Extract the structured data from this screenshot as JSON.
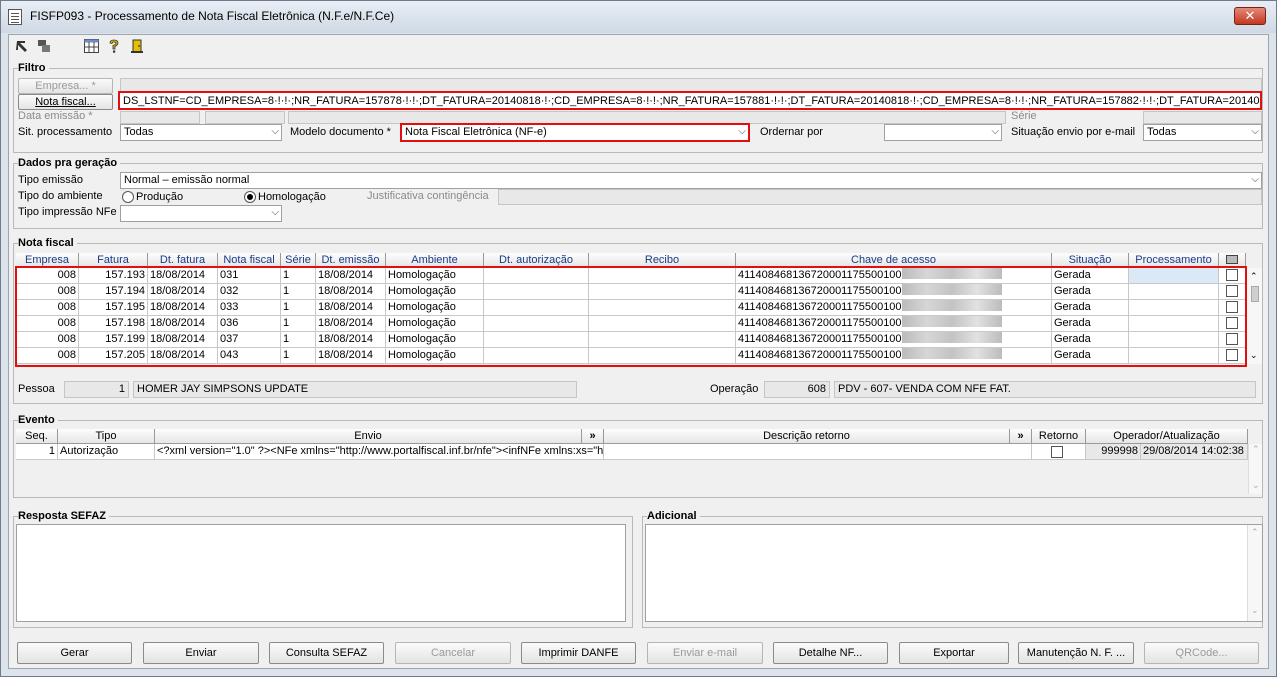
{
  "window": {
    "title": "FISFP093 - Processamento de Nota Fiscal Eletrônica (N.F.e/N.F.Ce)",
    "close_label": "✕"
  },
  "toolbar": {
    "icons": [
      "arrow-exit-icon",
      "window-icon",
      "grid-icon",
      "help-icon",
      "door-exit-icon"
    ]
  },
  "filtro": {
    "title": "Filtro",
    "empresa_label": "Empresa... *",
    "nota_fiscal_label": "Nota fiscal...",
    "nota_fiscal_value": "DS_LSTNF=CD_EMPRESA=8·!·!·;NR_FATURA=157878·!·!·;DT_FATURA=20140818·!·;CD_EMPRESA=8·!·!·;NR_FATURA=157881·!·!·;DT_FATURA=20140818·!·;CD_EMPRESA=8·!·!·;NR_FATURA=157882·!·!·;DT_FATURA=20140818·!·;CD_EMP",
    "data_emissao_label": "Data emissão *",
    "serie_label": "Série",
    "sit_processamento_label": "Sit. processamento",
    "sit_processamento_value": "Todas",
    "modelo_documento_label": "Modelo documento *",
    "modelo_documento_value": "Nota Fiscal Eletrônica (NF-e)",
    "ordenar_por_label": "Ordernar por",
    "ordenar_por_value": "",
    "situacao_envio_label": "Situação envio por e-mail",
    "situacao_envio_value": "Todas"
  },
  "dados": {
    "title": "Dados pra geração",
    "tipo_emissao_label": "Tipo emissão",
    "tipo_emissao_value": "Normal – emissão normal",
    "tipo_ambiente_label": "Tipo do ambiente",
    "radio_producao": "Produção",
    "radio_homologacao": "Homologação",
    "ambiente_selected": "Homologação",
    "justificativa_label": "Justificativa contingência",
    "tipo_impressao_label": "Tipo impressão NFe",
    "tipo_impressao_value": ""
  },
  "nota_fiscal": {
    "title": "Nota fiscal",
    "columns": [
      "Empresa",
      "Fatura",
      "Dt. fatura",
      "Nota fiscal",
      "Série",
      "Dt. emissão",
      "Ambiente",
      "Dt. autorização",
      "Recibo",
      "Chave de acesso",
      "Situação",
      "Processamento"
    ],
    "rows": [
      {
        "empresa": "008",
        "fatura": "157.193",
        "dt_fatura": "18/08/2014",
        "nota": "031",
        "serie": "1",
        "dt_emissao": "18/08/2014",
        "ambiente": "Homologação",
        "dt_aut": "",
        "recibo": "",
        "chave": "411408468136720001175500100",
        "situacao": "Gerada",
        "proc": "",
        "checked": false
      },
      {
        "empresa": "008",
        "fatura": "157.194",
        "dt_fatura": "18/08/2014",
        "nota": "032",
        "serie": "1",
        "dt_emissao": "18/08/2014",
        "ambiente": "Homologação",
        "dt_aut": "",
        "recibo": "",
        "chave": "411408468136720001175500100",
        "situacao": "Gerada",
        "proc": "",
        "checked": false
      },
      {
        "empresa": "008",
        "fatura": "157.195",
        "dt_fatura": "18/08/2014",
        "nota": "033",
        "serie": "1",
        "dt_emissao": "18/08/2014",
        "ambiente": "Homologação",
        "dt_aut": "",
        "recibo": "",
        "chave": "411408468136720001175500100",
        "situacao": "Gerada",
        "proc": "",
        "checked": false
      },
      {
        "empresa": "008",
        "fatura": "157.198",
        "dt_fatura": "18/08/2014",
        "nota": "036",
        "serie": "1",
        "dt_emissao": "18/08/2014",
        "ambiente": "Homologação",
        "dt_aut": "",
        "recibo": "",
        "chave": "411408468136720001175500100",
        "situacao": "Gerada",
        "proc": "",
        "checked": false
      },
      {
        "empresa": "008",
        "fatura": "157.199",
        "dt_fatura": "18/08/2014",
        "nota": "037",
        "serie": "1",
        "dt_emissao": "18/08/2014",
        "ambiente": "Homologação",
        "dt_aut": "",
        "recibo": "",
        "chave": "411408468136720001175500100",
        "situacao": "Gerada",
        "proc": "",
        "checked": false
      },
      {
        "empresa": "008",
        "fatura": "157.205",
        "dt_fatura": "18/08/2014",
        "nota": "043",
        "serie": "1",
        "dt_emissao": "18/08/2014",
        "ambiente": "Homologação",
        "dt_aut": "",
        "recibo": "",
        "chave": "411408468136720001175500100",
        "situacao": "Gerada",
        "proc": "",
        "checked": false
      }
    ],
    "pessoa_label": "Pessoa",
    "pessoa_code": "1",
    "pessoa_name": "HOMER JAY SIMPSONS UPDATE",
    "operacao_label": "Operação",
    "operacao_code": "608",
    "operacao_name": "PDV - 607- VENDA COM NFE FAT."
  },
  "evento": {
    "title": "Evento",
    "columns": [
      "Seq.",
      "Tipo",
      "Envio",
      "»",
      "Descrição retorno",
      "»",
      "Retorno",
      "Operador/Atualização"
    ],
    "rows": [
      {
        "seq": "1",
        "tipo": "Autorização",
        "envio": "<?xml version=\"1.0\" ?><NFe xmlns=\"http://www.portalfiscal.inf.br/nfe\"><infNFe xmlns:xs=\"h",
        "descricao": "",
        "retorno": false,
        "operador": "999998",
        "atualizacao": "29/08/2014 14:02:38"
      }
    ]
  },
  "resposta": {
    "title": "Resposta SEFAZ",
    "value": ""
  },
  "adicional": {
    "title": "Adicional",
    "value": ""
  },
  "buttons": {
    "gerar": "Gerar",
    "enviar": "Enviar",
    "consulta": "Consulta SEFAZ",
    "cancelar": "Cancelar",
    "imprimir": "Imprimir DANFE",
    "enviar_email": "Enviar e-mail",
    "detalhe": "Detalhe NF...",
    "exportar": "Exportar",
    "manutencao": "Manutenção N. F. ...",
    "qrcode": "QRCode..."
  },
  "colors": {
    "highlight": "#e01010",
    "header_text": "#1a3a8a"
  }
}
